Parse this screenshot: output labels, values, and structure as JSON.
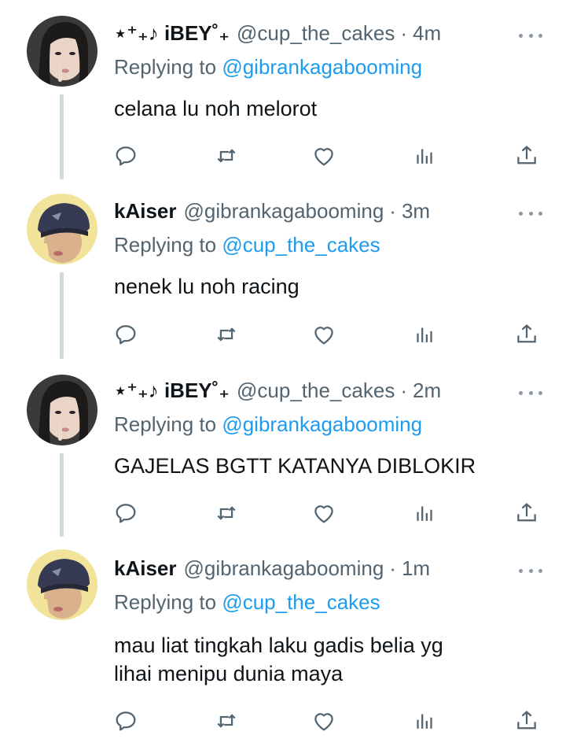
{
  "tweets": [
    {
      "display_name": "⋆⁺₊♪ iBEY˚₊",
      "handle": "@cup_the_cakes",
      "separator": "·",
      "time": "4m",
      "replying_prefix": "Replying to",
      "replying_to": "@gibrankagabooming",
      "text": "celana lu noh melorot",
      "avatar": "avatar-female"
    },
    {
      "display_name": "kAiser",
      "handle": "@gibrankagabooming",
      "separator": "·",
      "time": "3m",
      "replying_prefix": "Replying to",
      "replying_to": "@cup_the_cakes",
      "text": "nenek lu noh racing",
      "avatar": "avatar-male"
    },
    {
      "display_name": "⋆⁺₊♪ iBEY˚₊",
      "handle": "@cup_the_cakes",
      "separator": "·",
      "time": "2m",
      "replying_prefix": "Replying to",
      "replying_to": "@gibrankagabooming",
      "text": "GAJELAS BGTT KATANYA DIBLOKIR",
      "avatar": "avatar-female"
    },
    {
      "display_name": "kAiser",
      "handle": "@gibrankagabooming",
      "separator": "·",
      "time": "1m",
      "replying_prefix": "Replying to",
      "replying_to": "@cup_the_cakes",
      "text": "mau liat tingkah laku gadis belia yg\nlihai menipu dunia maya",
      "avatar": "avatar-male"
    }
  ],
  "icons": {
    "reply": "reply-icon",
    "retweet": "retweet-icon",
    "like": "heart-icon",
    "views": "views-icon",
    "share": "share-icon",
    "more": "more-icon"
  },
  "colors": {
    "text": "#0f1419",
    "secondary": "#536471",
    "mention": "#1d9bf0",
    "thread_line": "#cfd9de"
  }
}
